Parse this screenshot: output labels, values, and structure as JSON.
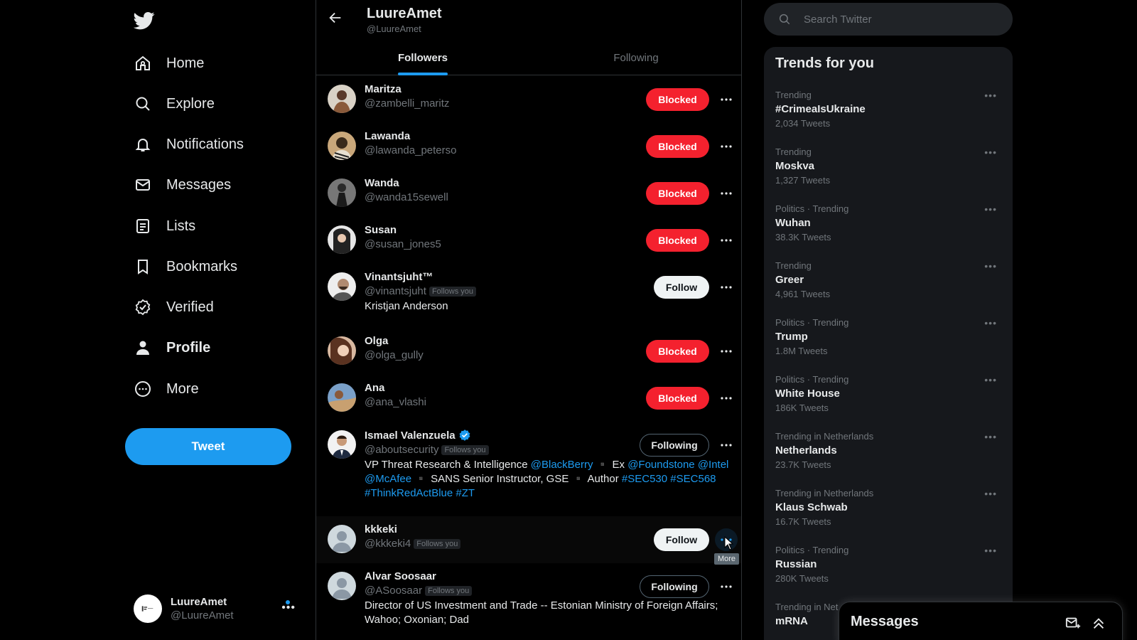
{
  "nav": {
    "items": [
      {
        "label": "Home",
        "icon": "home-icon"
      },
      {
        "label": "Explore",
        "icon": "search-icon"
      },
      {
        "label": "Notifications",
        "icon": "bell-icon"
      },
      {
        "label": "Messages",
        "icon": "mail-icon"
      },
      {
        "label": "Lists",
        "icon": "list-icon"
      },
      {
        "label": "Bookmarks",
        "icon": "bookmark-icon"
      },
      {
        "label": "Verified",
        "icon": "verified-icon"
      },
      {
        "label": "Profile",
        "icon": "person-icon",
        "active": true
      },
      {
        "label": "More",
        "icon": "more-circle-icon"
      }
    ],
    "tweet_label": "Tweet",
    "account": {
      "name": "LuureAmet",
      "handle": "@LuureAmet"
    }
  },
  "header": {
    "title": "LuureAmet",
    "handle": "@LuureAmet",
    "tabs": [
      {
        "label": "Followers",
        "active": true
      },
      {
        "label": "Following",
        "active": false
      }
    ]
  },
  "users": [
    {
      "name": "Maritza",
      "handle": "@zambelli_maritz",
      "button": "Blocked"
    },
    {
      "name": "Lawanda",
      "handle": "@lawanda_peterso",
      "button": "Blocked"
    },
    {
      "name": "Wanda",
      "handle": "@wanda15sewell",
      "button": "Blocked"
    },
    {
      "name": "Susan",
      "handle": "@susan_jones5",
      "button": "Blocked"
    },
    {
      "name": "Vinantsjuht™",
      "handle": "@vinantsjuht",
      "follows_you": "Follows you",
      "button": "Follow",
      "bio": "Kristjan Anderson"
    },
    {
      "name": "Olga",
      "handle": "@olga_gully",
      "button": "Blocked"
    },
    {
      "name": "Ana",
      "handle": "@ana_vlashi",
      "button": "Blocked"
    },
    {
      "name": "Ismael Valenzuela",
      "handle": "@aboutsecurity",
      "follows_you": "Follows you",
      "button": "Following",
      "verified": true,
      "bio_parts": [
        "VP Threat Research & Intelligence ",
        "@BlackBerry",
        " ▪️ Ex ",
        "@Foundstone",
        " ",
        "@Intel",
        " ",
        "@McAfee",
        " ▪️ SANS Senior Instructor, GSE ▪️ Author ",
        "#SEC530",
        " ",
        "#SEC568",
        " ",
        "#ThinkRedActBlue",
        " ",
        "#ZT"
      ]
    },
    {
      "name": "kkkeki",
      "handle": "@kkkeki4",
      "follows_you": "Follows you",
      "button": "Follow",
      "tooltip": "More"
    },
    {
      "name": "Alvar Soosaar",
      "handle": "@ASoosaar",
      "follows_you": "Follows you",
      "button": "Following",
      "bio": "Director of US Investment and Trade -- Estonian Ministry of Foreign Affairs; Wahoo; Oxonian; Dad"
    }
  ],
  "search": {
    "placeholder": "Search Twitter"
  },
  "trends": {
    "title": "Trends for you",
    "items": [
      {
        "context": "Trending",
        "name": "#CrimeaIsUkraine",
        "count": "2,034 Tweets"
      },
      {
        "context": "Trending",
        "name": "Moskva",
        "count": "1,327 Tweets"
      },
      {
        "context": "Politics · Trending",
        "name": "Wuhan",
        "count": "38.3K Tweets"
      },
      {
        "context": "Trending",
        "name": "Greer",
        "count": "4,961 Tweets"
      },
      {
        "context": "Politics · Trending",
        "name": "Trump",
        "count": "1.8M Tweets"
      },
      {
        "context": "Politics · Trending",
        "name": "White House",
        "count": "186K Tweets"
      },
      {
        "context": "Trending in Netherlands",
        "name": "Netherlands",
        "count": "23.7K Tweets"
      },
      {
        "context": "Trending in Netherlands",
        "name": "Klaus Schwab",
        "count": "16.7K Tweets"
      },
      {
        "context": "Politics · Trending",
        "name": "Russian",
        "count": "280K Tweets"
      },
      {
        "context": "Trending in Net",
        "name": "mRNA",
        "count": ""
      }
    ]
  },
  "messages_dock": {
    "title": "Messages"
  },
  "colors": {
    "accent": "#1d9bf0",
    "blocked": "#f4212e",
    "background": "#000000"
  }
}
